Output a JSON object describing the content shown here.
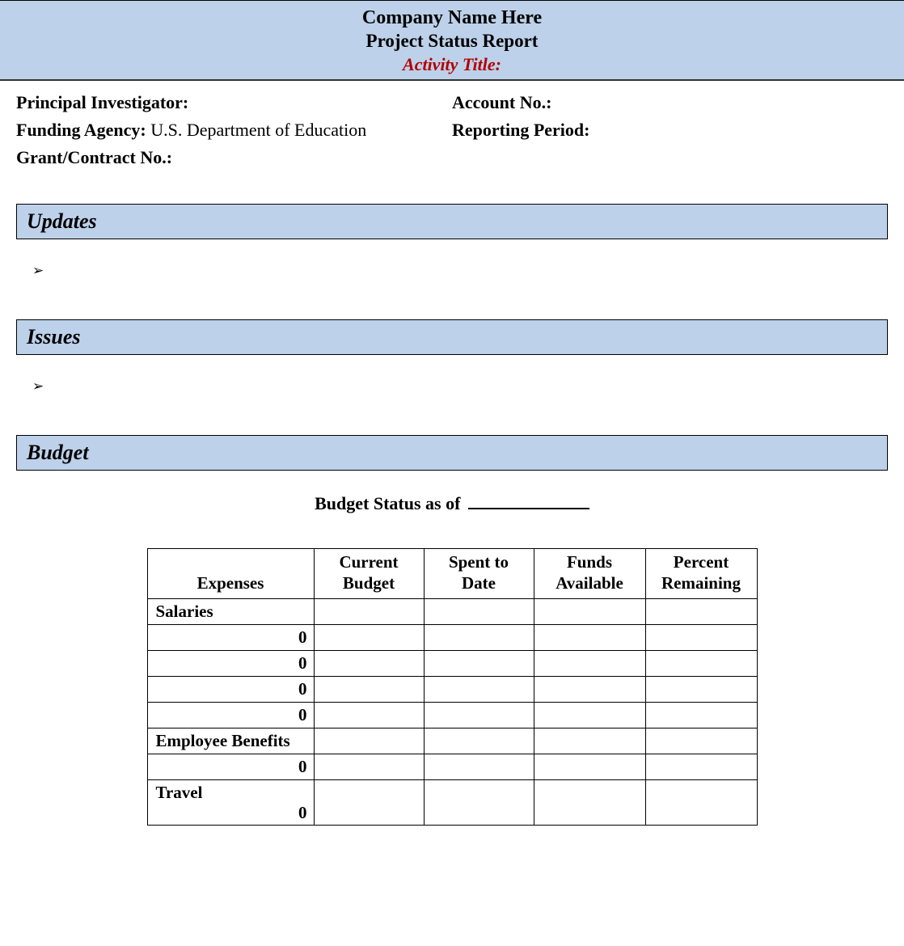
{
  "banner": {
    "company": "Company Name Here",
    "report_title": "Project Status Report",
    "activity_label": "Activity Title:"
  },
  "meta": {
    "pi_label": "Principal Investigator:",
    "account_label": "Account No.:",
    "funding_label": "Funding Agency:",
    "funding_value": "U.S. Department of Education",
    "period_label": "Reporting Period:",
    "grant_label": "Grant/Contract No.:"
  },
  "sections": {
    "updates": "Updates",
    "issues": "Issues",
    "budget": "Budget"
  },
  "bullet_glyph": "➢",
  "budget_status_label": "Budget Status as of",
  "table": {
    "headers": {
      "expenses": "Expenses",
      "current_budget_l1": "Current",
      "current_budget_l2": "Budget",
      "spent_l1": "Spent to",
      "spent_l2": "Date",
      "funds_l1": "Funds",
      "funds_l2": "Available",
      "percent_l1": "Percent",
      "percent_l2": "Remaining"
    },
    "rows": [
      {
        "type": "label",
        "text": "Salaries"
      },
      {
        "type": "zero",
        "text": "0"
      },
      {
        "type": "zero",
        "text": "0"
      },
      {
        "type": "zero",
        "text": "0"
      },
      {
        "type": "zero",
        "text": "0"
      },
      {
        "type": "label",
        "text": "Employee Benefits"
      },
      {
        "type": "zero",
        "text": "0"
      },
      {
        "type": "combo",
        "label": "Travel",
        "zero": "0"
      }
    ]
  }
}
